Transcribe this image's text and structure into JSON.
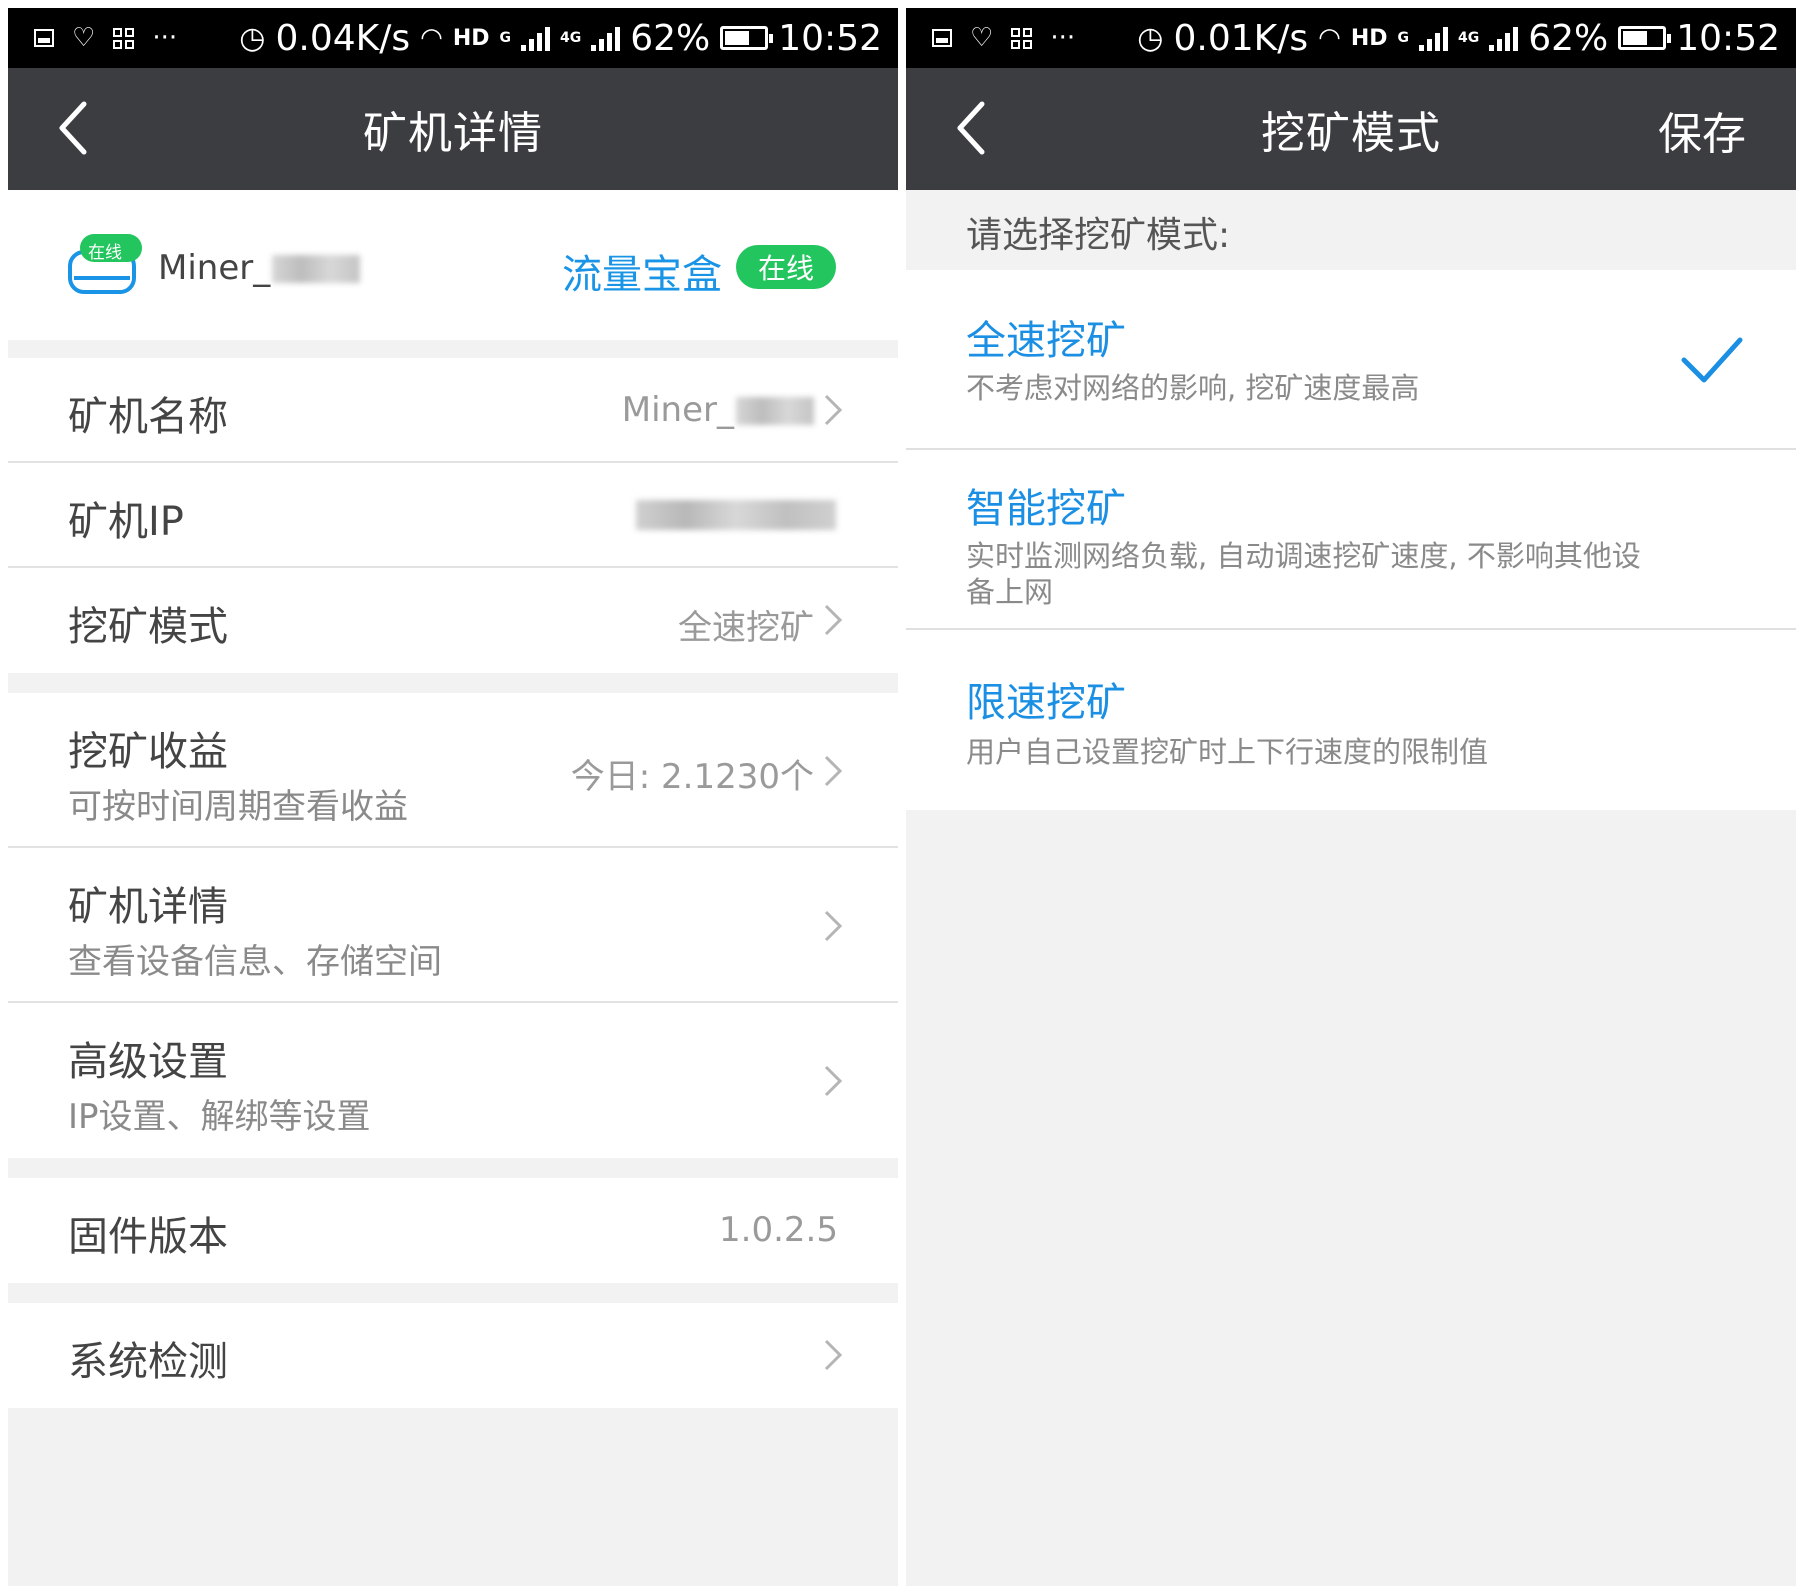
{
  "left": {
    "status": {
      "speed": "0.04K/s",
      "hd": "HD",
      "battery": "62%",
      "time": "10:52",
      "net_g": "G",
      "net_4g": "4G",
      "more": "···"
    },
    "header": {
      "title": "矿机详情"
    },
    "miner": {
      "badge": "在线",
      "name_prefix": "Miner_",
      "brand": "流量宝盒",
      "status": "在线"
    },
    "rows": {
      "name": {
        "label": "矿机名称",
        "value_prefix": "Miner_"
      },
      "ip": {
        "label": "矿机IP"
      },
      "mode": {
        "label": "挖矿模式",
        "value": "全速挖矿"
      },
      "earnings": {
        "label": "挖矿收益",
        "sub": "可按时间周期查看收益",
        "value": "今日: 2.1230个"
      },
      "details": {
        "label": "矿机详情",
        "sub": "查看设备信息、存储空间"
      },
      "advanced": {
        "label": "高级设置",
        "sub": "IP设置、解绑等设置"
      },
      "firmware": {
        "label": "固件版本",
        "value": "1.0.2.5"
      },
      "diagnose": {
        "label": "系统检测"
      }
    }
  },
  "right": {
    "status": {
      "speed": "0.01K/s",
      "hd": "HD",
      "battery": "62%",
      "time": "10:52",
      "net_g": "G",
      "net_4g": "4G",
      "more": "···"
    },
    "header": {
      "title": "挖矿模式",
      "save": "保存"
    },
    "prompt": "请选择挖矿模式:",
    "modes": [
      {
        "title": "全速挖矿",
        "desc": "不考虑对网络的影响, 挖矿速度最高",
        "selected": true
      },
      {
        "title": "智能挖矿",
        "desc": "实时监测网络负载, 自动调速挖矿速度, 不影响其他设备上网",
        "selected": false
      },
      {
        "title": "限速挖矿",
        "desc": "用户自己设置挖矿时上下行速度的限制值",
        "selected": false
      }
    ]
  },
  "colors": {
    "header_bg": "#3c3d41",
    "accent_blue": "#1a8fe3",
    "online_green": "#22c55e",
    "page_bg": "#f2f2f2"
  },
  "battery_level": 0.62
}
